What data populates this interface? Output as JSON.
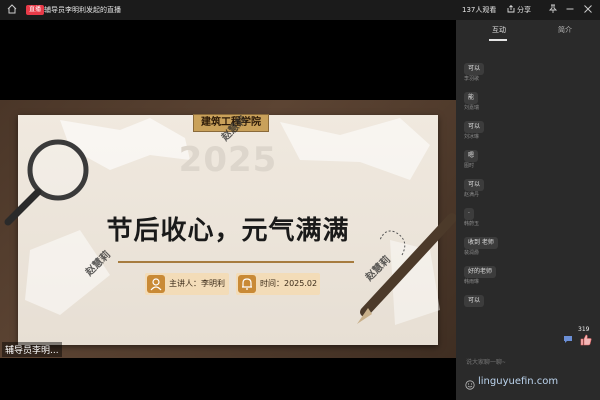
{
  "header": {
    "live_tag": "直播",
    "title": "辅导员李明利发起的直播",
    "viewers": "137人观看",
    "share_label": "分享"
  },
  "slide": {
    "school": "建筑工程学院",
    "year": "2025",
    "headline": "节后收心，元气满满",
    "speaker": "主讲人：李明利",
    "time": "时间：2025.02",
    "watermark": "赵慧莉"
  },
  "camera_label": "辅导员李明...",
  "panel": {
    "tabs": [
      "互动",
      "简介"
    ],
    "messages": [
      {
        "name": "",
        "text": "可以"
      },
      {
        "name": "李羽歌",
        "text": "能"
      },
      {
        "name": "刘嘉瑞",
        "text": "可以"
      },
      {
        "name": "刘冰琳",
        "text": "嗯"
      },
      {
        "name": "图时",
        "text": "可以"
      },
      {
        "name": "赵满丹",
        "text": "·"
      },
      {
        "name": "韩蔚玉",
        "text": "收到 老师"
      },
      {
        "name": "裴润爵",
        "text": "好的老师"
      },
      {
        "name": "韩雨琳",
        "text": "可以"
      }
    ],
    "like_count": "319",
    "input_placeholder": "说大家聊一聊~"
  },
  "site_watermark": "linguyuefin.com",
  "colors": {
    "accent_red": "#e83a48",
    "panel_bg": "#2a2a2a",
    "slide_gold": "#c9a15a"
  }
}
